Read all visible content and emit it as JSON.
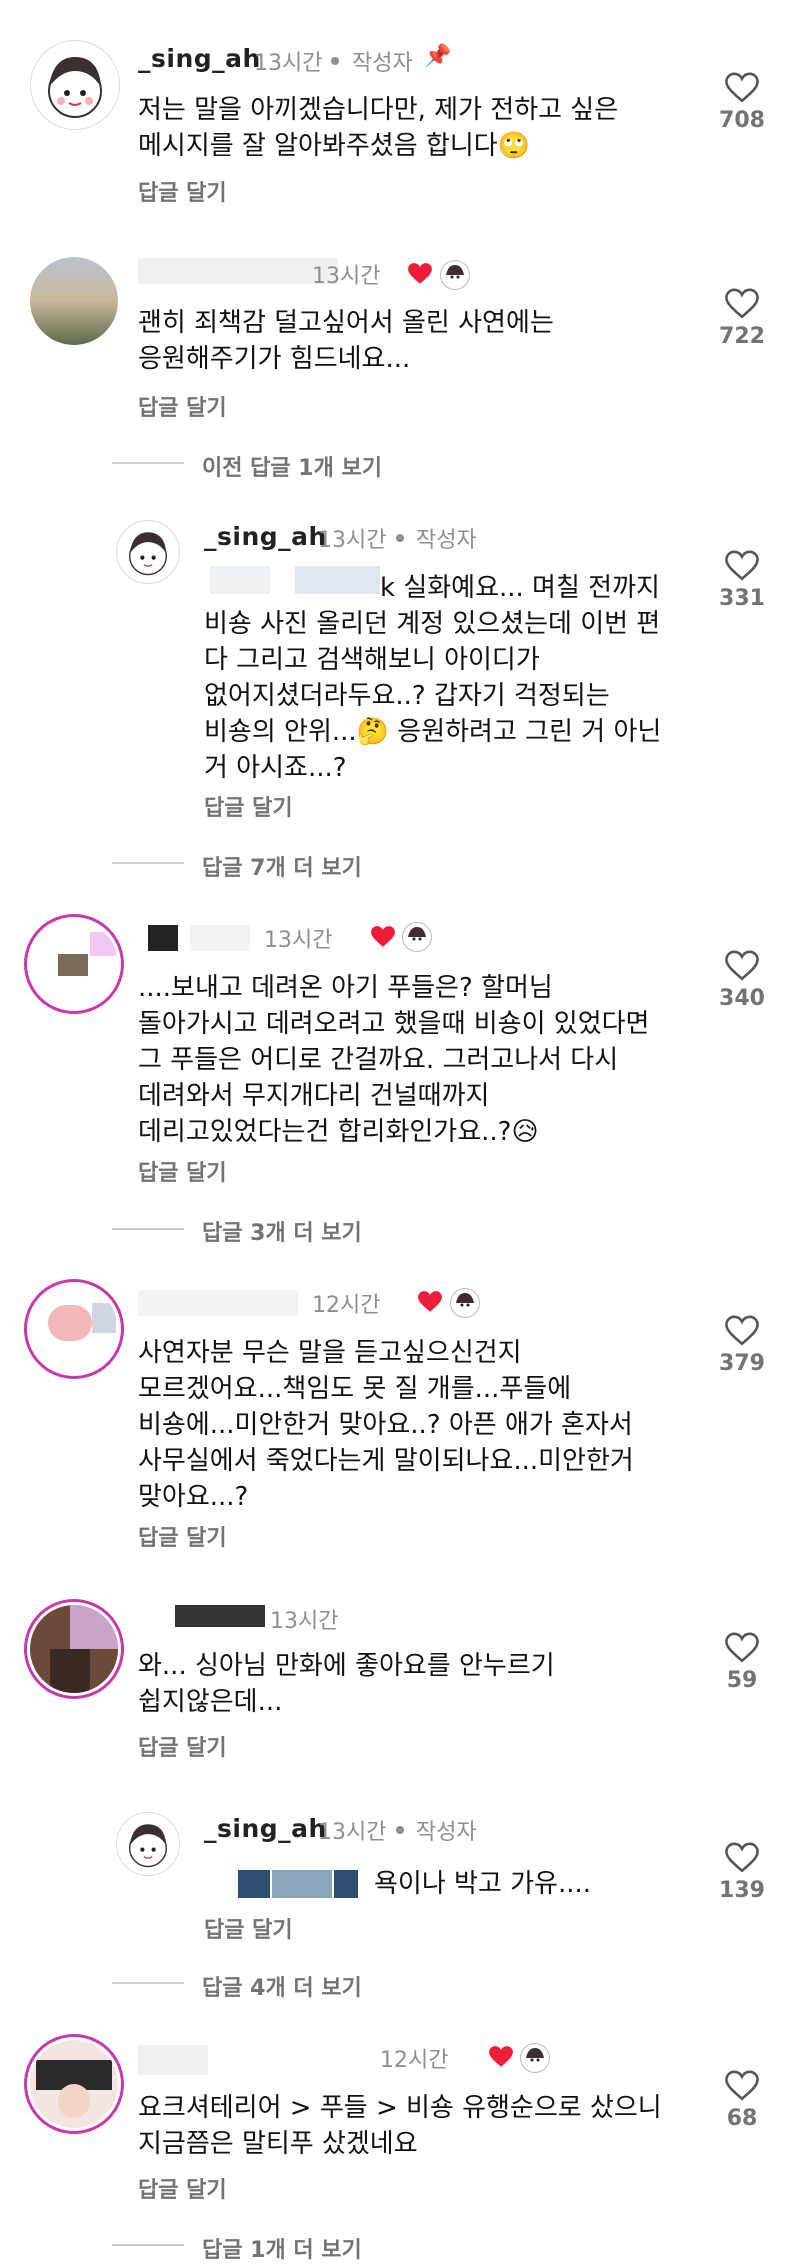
{
  "comments": [
    {
      "username": "_sing_ah",
      "time": "13시간",
      "author_tag": "작성자",
      "text": [
        "저는 말을 아끼겠습니다만, 제가 전하고 싶은",
        "메시지를 잘 알아봐주셨음 합니다🙄"
      ],
      "reply_label": "답글 달기",
      "likes": "708"
    },
    {
      "username": "",
      "time": "13시간",
      "text": [
        "괜히 죄책감 덜고싶어서 올린 사연에는",
        "응원해주기가 힘드네요..."
      ],
      "reply_label": "답글 달기",
      "likes": "722",
      "prev_replies": "이전 답글 1개 보기"
    },
    {
      "username": "_sing_ah",
      "time": "13시간",
      "author_tag": "작성자",
      "text_prefix": "k 실화예요... 며칠 전까지",
      "text": [
        "비숑 사진 올리던 계정 있으셨는데 이번 편",
        "다 그리고 검색해보니 아이디가",
        "없어지셨더라두요..? 갑자기 걱정되는",
        "비숑의 안위...🤔 응원하려고 그린 거 아닌",
        "거 아시죠...?"
      ],
      "reply_label": "답글 달기",
      "likes": "331",
      "more_replies": "답글 7개 더 보기"
    },
    {
      "username": "",
      "time": "13시간",
      "text": [
        "....보내고 데려온 아기 푸들은? 할머님",
        "돌아가시고 데려오려고 했을때 비숑이 있었다면",
        "그 푸들은 어디로 간걸까요. 그러고나서 다시",
        "데려와서 무지개다리 건널때까지",
        "데리고있었다는건 합리화인가요..?😥"
      ],
      "reply_label": "답글 달기",
      "likes": "340",
      "more_replies": "답글 3개 더 보기"
    },
    {
      "username": "",
      "time": "12시간",
      "text": [
        "사연자분 무슨 말을 듣고싶으신건지",
        "모르겠어요...책임도 못 질 개를...푸들에",
        "비숑에...미안한거 맞아요..? 아픈 애가 혼자서",
        "사무실에서 죽었다는게 말이되나요...미안한거",
        "맞아요...?"
      ],
      "reply_label": "답글 달기",
      "likes": "379"
    },
    {
      "username": "",
      "time": "13시간",
      "text": [
        "와... 싱아님 만화에 좋아요를 안누르기",
        "쉽지않은데..."
      ],
      "reply_label": "답글 달기",
      "likes": "59"
    },
    {
      "username": "_sing_ah",
      "time": "13시간",
      "author_tag": "작성자",
      "text_prefix": "욕이나 박고 가유....",
      "text": [],
      "reply_label": "답글 달기",
      "likes": "139",
      "more_replies": "답글 4개 더 보기"
    },
    {
      "username": "",
      "time": "12시간",
      "text": [
        "요크셔테리어 > 푸들 > 비숑 유행순으로 샀으니",
        "지금쯤은 말티푸 샀겠네요"
      ],
      "reply_label": "답글 달기",
      "likes": "68",
      "more_replies": "답글 1개 더 보기"
    }
  ],
  "colors": {
    "heart_red": "#ed1d3a",
    "muted": "#8e8e8e"
  }
}
